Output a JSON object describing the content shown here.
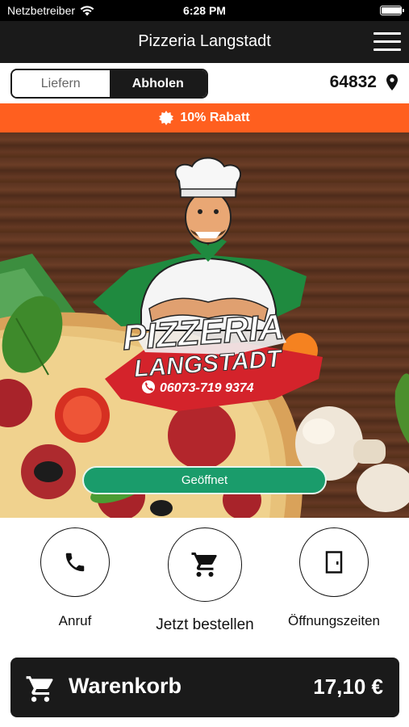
{
  "status_bar": {
    "carrier": "Netzbetreiber",
    "time": "6:28 PM",
    "battery_level": 0.95
  },
  "header": {
    "title": "Pizzeria Langstadt"
  },
  "mode_toggle": {
    "deliver_label": "Liefern",
    "pickup_label": "Abholen",
    "selected": "Abholen"
  },
  "location": {
    "zip": "64832",
    "icon": "map-pin-icon"
  },
  "banner": {
    "text": "10% Rabatt",
    "icon": "badge-icon",
    "color": "#ff5f1f"
  },
  "hero": {
    "logo_line1": "PIZZERIA",
    "logo_line2": "LANGSTADT",
    "logo_phone": "06073-719 9374",
    "status_label": "Geöffnet",
    "status_color": "#1a9c6b"
  },
  "actions": [
    {
      "label": "Anruf",
      "icon": "phone-icon"
    },
    {
      "label": "Jetzt bestellen",
      "icon": "cart-icon"
    },
    {
      "label": "Öffnungszeiten",
      "icon": "door-icon"
    }
  ],
  "cart": {
    "label": "Warenkorb",
    "total": "17,10 €",
    "icon": "cart-icon"
  },
  "colors": {
    "dark": "#1a1a1a",
    "accent_orange": "#ff5f1f",
    "open_green": "#1a9c6b"
  }
}
